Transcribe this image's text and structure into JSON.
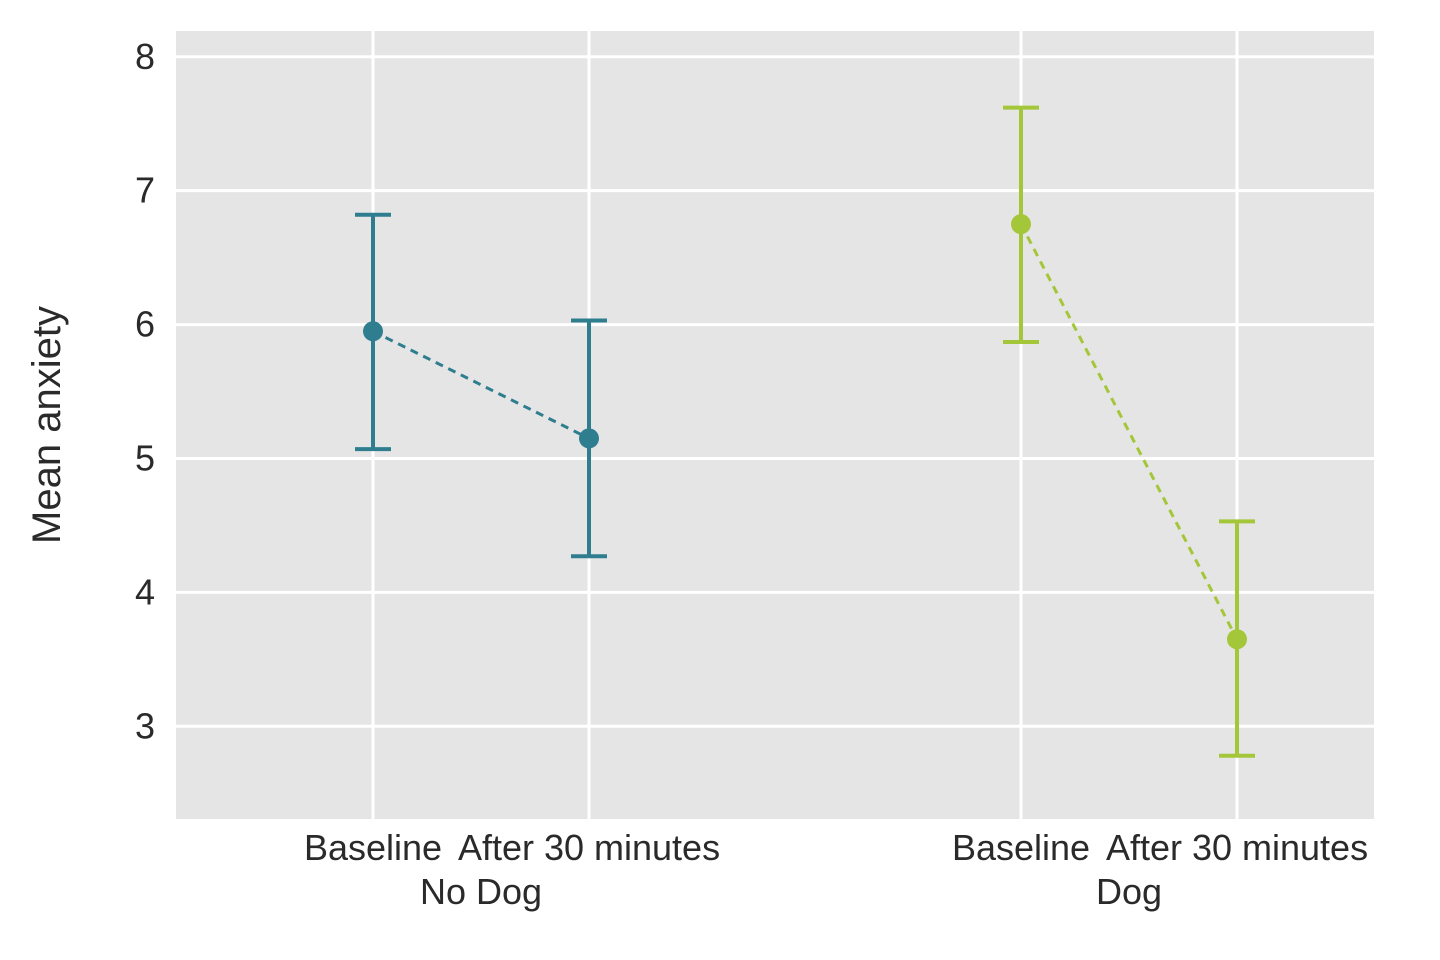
{
  "chart_data": {
    "type": "errorbar",
    "ylabel": "Mean anxiety",
    "xlabel": "",
    "ylim": [
      2.3,
      8.2
    ],
    "yticks": [
      3,
      4,
      5,
      6,
      7,
      8
    ],
    "groups": [
      {
        "name": "No Dog",
        "color": "#2e7e8f"
      },
      {
        "name": "Dog",
        "color": "#a4c639"
      }
    ],
    "x_sublevels": [
      "Baseline",
      "After 30 minutes"
    ],
    "series": [
      {
        "group": "No Dog",
        "color": "#2e7e8f",
        "points": [
          {
            "x_label": "Baseline",
            "mean": 5.95,
            "low": 5.07,
            "high": 6.82
          },
          {
            "x_label": "After 30 minutes",
            "mean": 5.15,
            "low": 4.27,
            "high": 6.03
          }
        ]
      },
      {
        "group": "Dog",
        "color": "#a4c639",
        "points": [
          {
            "x_label": "Baseline",
            "mean": 6.75,
            "low": 5.87,
            "high": 7.62
          },
          {
            "x_label": "After 30 minutes",
            "mean": 3.65,
            "low": 2.78,
            "high": 4.53
          }
        ]
      }
    ],
    "grid": true,
    "title": ""
  }
}
